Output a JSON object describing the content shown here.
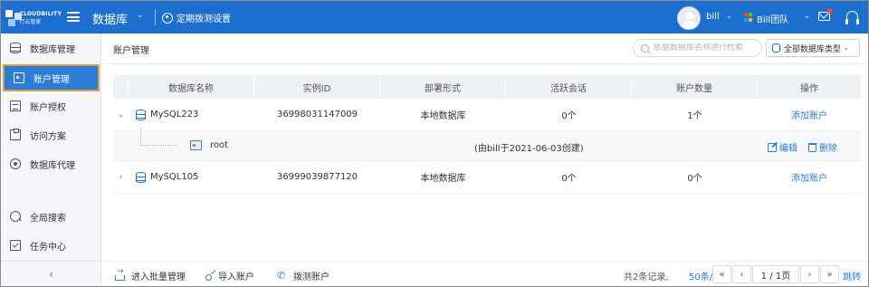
{
  "header": {
    "logo_line1": "CLOUDBILITY",
    "logo_line2": "行云管家",
    "module_title": "数据库",
    "module_caret": "⌄",
    "schedule_label": "定期拨测设置",
    "user_name": "bill",
    "team_name": "Bill团队",
    "caret": "⌄"
  },
  "sidebar": {
    "items": [
      {
        "label": "数据库管理",
        "icon": "database-icon"
      },
      {
        "label": "账户管理",
        "icon": "account-card-icon",
        "active": true
      },
      {
        "label": "账户授权",
        "icon": "document-icon"
      },
      {
        "label": "访问方案",
        "icon": "clipboard-icon"
      },
      {
        "label": "数据库代理",
        "icon": "proxy-icon"
      },
      {
        "label": "全局搜索",
        "icon": "search-icon"
      },
      {
        "label": "任务中心",
        "icon": "task-icon"
      }
    ],
    "collapse_glyph": "‹"
  },
  "main": {
    "breadcrumb": "账户管理",
    "search_placeholder": "依据数据库名称进行检索",
    "db_type_filter": "全部数据库类型",
    "db_type_caret": "⌄"
  },
  "table": {
    "columns": [
      "数据库名称",
      "实例ID",
      "部署形式",
      "活跃会话",
      "账户数量",
      "操作"
    ],
    "rows": [
      {
        "expand": "⌄",
        "name": "MySQL223",
        "instance_id": "36998031147009",
        "deploy": "本地数据库",
        "sessions": "0个",
        "accounts": "1个",
        "action": "添加账户"
      },
      {
        "expand": "›",
        "name": "MySQL105",
        "instance_id": "36999039877120",
        "deploy": "本地数据库",
        "sessions": "0个",
        "accounts": "0个",
        "action": "添加账户"
      }
    ],
    "sub_row": {
      "account": "root",
      "note": "(由bill于2021-06-03创建)",
      "edit_label": "编辑",
      "delete_label": "删除"
    }
  },
  "footer": {
    "batch_manage": "进入批量管理",
    "import_accounts": "导入账户",
    "probe_accounts": "拨测账户",
    "total": "共2条记录,",
    "page_size": "50条/页",
    "first": "«",
    "prev": "‹",
    "current": "1 / 1页",
    "next": "›",
    "last": "»",
    "jump": "跳转"
  },
  "colors": {
    "topbar": "#1c6fce",
    "accent": "#2b7dd8",
    "active_outline": "#d9a23a"
  }
}
